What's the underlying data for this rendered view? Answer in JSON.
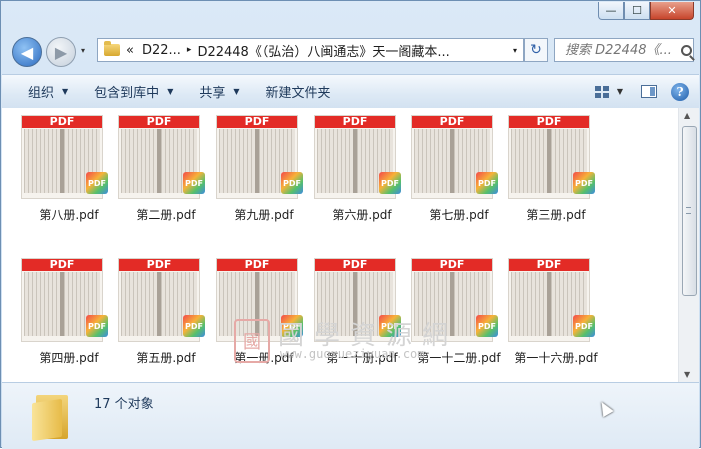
{
  "window": {
    "minimize_label": "—",
    "maximize_label": "☐",
    "close_label": "✕"
  },
  "nav": {
    "back_icon": "back-arrow-icon",
    "forward_icon": "forward-arrow-icon",
    "history_dropdown_icon": "▾"
  },
  "address": {
    "overflow_label": "«",
    "crumbs": [
      "D22...",
      "D22448《（弘治）八闽通志》天一阁藏本..."
    ],
    "separator": "▸",
    "dropdown": "▾",
    "refresh_glyph": "↻"
  },
  "search": {
    "placeholder": "搜索 D22448《..."
  },
  "toolbar": {
    "organize": "组织",
    "include_in_library": "包含到库中",
    "share": "共享",
    "new_folder": "新建文件夹",
    "caret": "▼",
    "views_caret": "▼",
    "help": "?"
  },
  "files": {
    "badge_text": "PDF",
    "icon_badge_text": "PDF",
    "items": [
      {
        "name": "第八册.pdf"
      },
      {
        "name": "第二册.pdf"
      },
      {
        "name": "第九册.pdf"
      },
      {
        "name": "第六册.pdf"
      },
      {
        "name": "第七册.pdf"
      },
      {
        "name": "第三册.pdf"
      },
      {
        "name": "第四册.pdf"
      },
      {
        "name": "第五册.pdf"
      },
      {
        "name": "第一册.pdf"
      },
      {
        "name": "第一十册.pdf"
      },
      {
        "name": "第一十二册.pdf"
      },
      {
        "name": "第一十六册.pdf"
      }
    ]
  },
  "watermark": {
    "seal": "國",
    "title": "國學資源網",
    "url": "www.guoxueziyuan.com"
  },
  "scrollbar": {
    "up": "▲",
    "down": "▼"
  },
  "status": {
    "count": "17 个对象"
  },
  "colors": {
    "pdf_red": "#e32b26",
    "toolbar_text": "#1e395b",
    "close_red": "#c7452c"
  }
}
